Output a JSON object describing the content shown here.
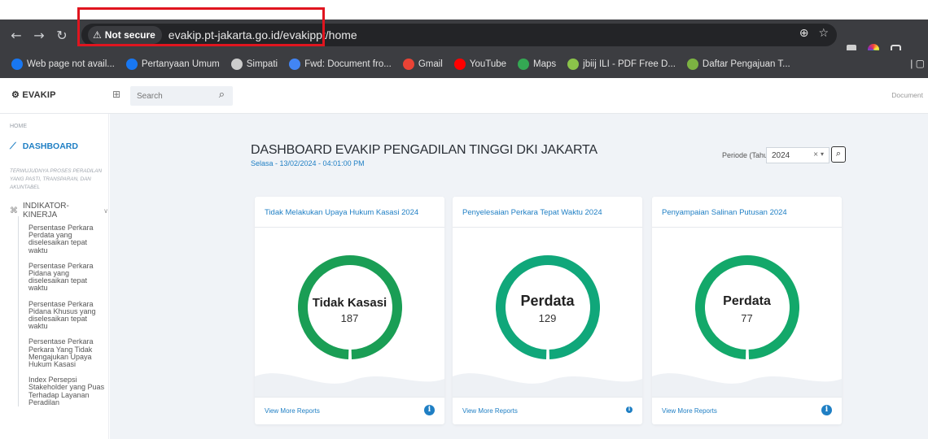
{
  "browser": {
    "security_label": "Not secure",
    "url": "evakip.pt-jakarta.go.id/evakippt/home",
    "bookmarks": [
      {
        "label": "Web page not avail...",
        "color": "#1877f2"
      },
      {
        "label": "Pertanyaan Umum",
        "color": "#1877f2"
      },
      {
        "label": "Simpati",
        "color": "#cccccc"
      },
      {
        "label": "Fwd: Document fro...",
        "color": "#4285f4"
      },
      {
        "label": "Gmail",
        "color": "#ea4335"
      },
      {
        "label": "YouTube",
        "color": "#ff0000"
      },
      {
        "label": "Maps",
        "color": "#34a853"
      },
      {
        "label": "jbiij ILI - PDF Free D...",
        "color": "#8bc34a"
      },
      {
        "label": "Daftar Pengajuan T...",
        "color": "#7cb342"
      }
    ]
  },
  "app": {
    "logo": "EVAKIP",
    "search_placeholder": "Search",
    "doc_link": "Document"
  },
  "sidebar": {
    "home": "HOME",
    "dashboard": "DASHBOARD",
    "section": "TERWUJUDNYA PROSES PERADILAN YANG PASTI, TRANSPARAN, DAN AKUNTABEL",
    "indikator": "INDIKATOR-KINERJA",
    "items": [
      "Persentase Perkara Perdata yang diselesaikan tepat waktu",
      "Persentase Perkara Pidana yang diselesaikan tepat waktu",
      "Persentase Perkara Pidana Khusus yang diselesaikan tepat waktu",
      "Persentase Perkara Perkara Yang Tidak Mengajukan Upaya Hukum Kasasi",
      "Index Persepsi Stakeholder yang Puas Terhadap Layanan Peradilan"
    ]
  },
  "main": {
    "title": "DASHBOARD EVAKIP PENGADILAN TINGGI DKI JAKARTA",
    "subtitle": "Selasa - 13/02/2024 - 04:01:00 PM",
    "periode_label": "Periode (Tahun)",
    "periode_value": "2024",
    "cards": [
      {
        "title": "Tidak Melakukan Upaya Hukum Kasasi 2024",
        "label": "Tidak Kasasi",
        "value": "187",
        "footer": "View More Reports",
        "color": "#1a9e55",
        "gap_fraction": 0.01
      },
      {
        "title": "Penyelesaian Perkara Tepat Waktu 2024",
        "label": "Perdata",
        "value": "129",
        "footer": "View More Reports",
        "color": "#10a77a",
        "gap_fraction": 0.01
      },
      {
        "title": "Penyampaian Salinan Putusan 2024",
        "label": "Perdata",
        "value": "77",
        "footer": "View More Reports",
        "color": "#13a86a",
        "gap_fraction": 0.01
      }
    ]
  }
}
